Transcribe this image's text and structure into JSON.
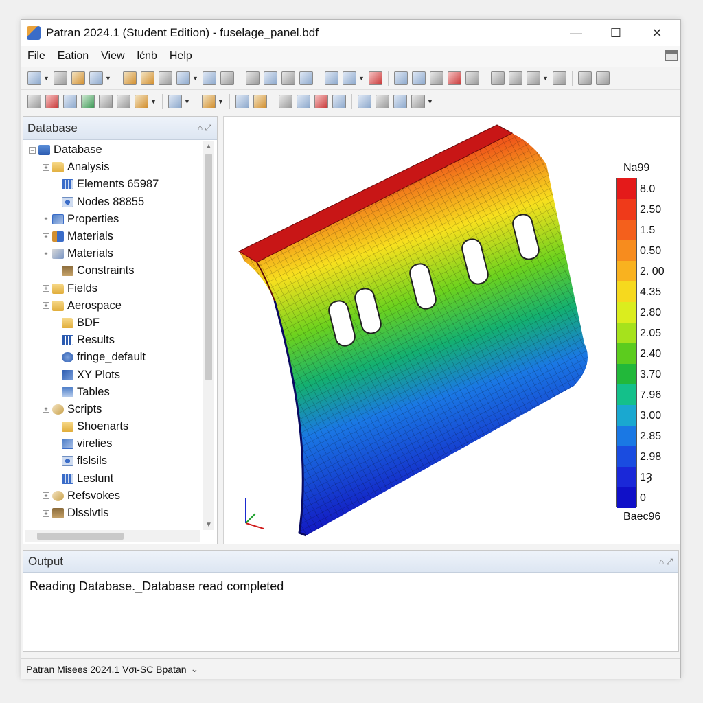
{
  "window": {
    "title": "Patran 2024.1 (Student Edition) - fuselage_panel.bdf",
    "minimize": "—",
    "maximize": "☐",
    "close": "✕"
  },
  "menu": [
    "File",
    "Eation",
    "View",
    "lćnb",
    "Help"
  ],
  "database_panel": {
    "title": "Database",
    "tree": [
      {
        "label": "Database",
        "icon": "database-icon",
        "expander": "−",
        "indent": 0
      },
      {
        "label": "Analysis",
        "icon": "folder-icon",
        "expander": "+",
        "indent": 1
      },
      {
        "label": "Elements 65987",
        "icon": "elements-icon",
        "expander": "",
        "indent": 2
      },
      {
        "label": "Nodes 88855",
        "icon": "nodes-icon",
        "expander": "",
        "indent": 2
      },
      {
        "label": "Properties",
        "icon": "properties-icon",
        "expander": "+",
        "indent": 1
      },
      {
        "label": "Materials",
        "icon": "materials-icon",
        "expander": "+",
        "indent": 1
      },
      {
        "label": "Materials",
        "icon": "materials-alt-icon",
        "expander": "+",
        "indent": 1
      },
      {
        "label": "Constraints",
        "icon": "constraints-icon",
        "expander": "",
        "indent": 2
      },
      {
        "label": "Fields",
        "icon": "folder-icon",
        "expander": "+",
        "indent": 1
      },
      {
        "label": "Aerospace",
        "icon": "folder-icon",
        "expander": "+",
        "indent": 1
      },
      {
        "label": "BDF",
        "icon": "folder-icon",
        "expander": "",
        "indent": 2
      },
      {
        "label": "Results",
        "icon": "results-icon",
        "expander": "",
        "indent": 2
      },
      {
        "label": "fringe_default",
        "icon": "fringe-icon",
        "expander": "",
        "indent": 2
      },
      {
        "label": "XY Plots",
        "icon": "xy-plot-icon",
        "expander": "",
        "indent": 2
      },
      {
        "label": "Tables",
        "icon": "table-icon",
        "expander": "",
        "indent": 2
      },
      {
        "label": "Scripts",
        "icon": "script-icon",
        "expander": "+",
        "indent": 1
      },
      {
        "label": "Shoenarts",
        "icon": "folder-icon",
        "expander": "",
        "indent": 2
      },
      {
        "label": "virelies",
        "icon": "properties-icon",
        "expander": "",
        "indent": 2
      },
      {
        "label": "flslsils",
        "icon": "nodes-icon",
        "expander": "",
        "indent": 2
      },
      {
        "label": "Leslunt",
        "icon": "elements-icon",
        "expander": "",
        "indent": 2
      },
      {
        "label": "Refsvokes",
        "icon": "script-icon",
        "expander": "+",
        "indent": 1
      },
      {
        "label": "Dlsslvtls",
        "icon": "constraints-icon",
        "expander": "+",
        "indent": 1
      }
    ]
  },
  "viewport": {
    "legend_title": "Na99",
    "legend_bottom": "Baec96",
    "legend_labels": [
      "8.0",
      "2.50",
      "1.5",
      "0.50",
      "2. 00",
      "4.35",
      "2.80",
      "2.05",
      "2.40",
      "3.70",
      "7.96",
      "3.00",
      "2.85",
      "2.98",
      "1Ȝ",
      "0"
    ],
    "legend_colors": [
      "#e41a1a",
      "#ef3a1a",
      "#f4601c",
      "#f78c1e",
      "#f9b21f",
      "#f6d91e",
      "#dbed1e",
      "#a6e21c",
      "#5ccc1e",
      "#22b83a",
      "#14c08a",
      "#1aa8d0",
      "#1a78e4",
      "#1a4ce0",
      "#1a28d8",
      "#1010c8"
    ]
  },
  "output_panel": {
    "title": "Output",
    "message": "Reading Database._Database read completed"
  },
  "status": {
    "text": "Patran Misees 2024.1  Vσι-SC Bpatan",
    "dropdown": "⌄"
  }
}
